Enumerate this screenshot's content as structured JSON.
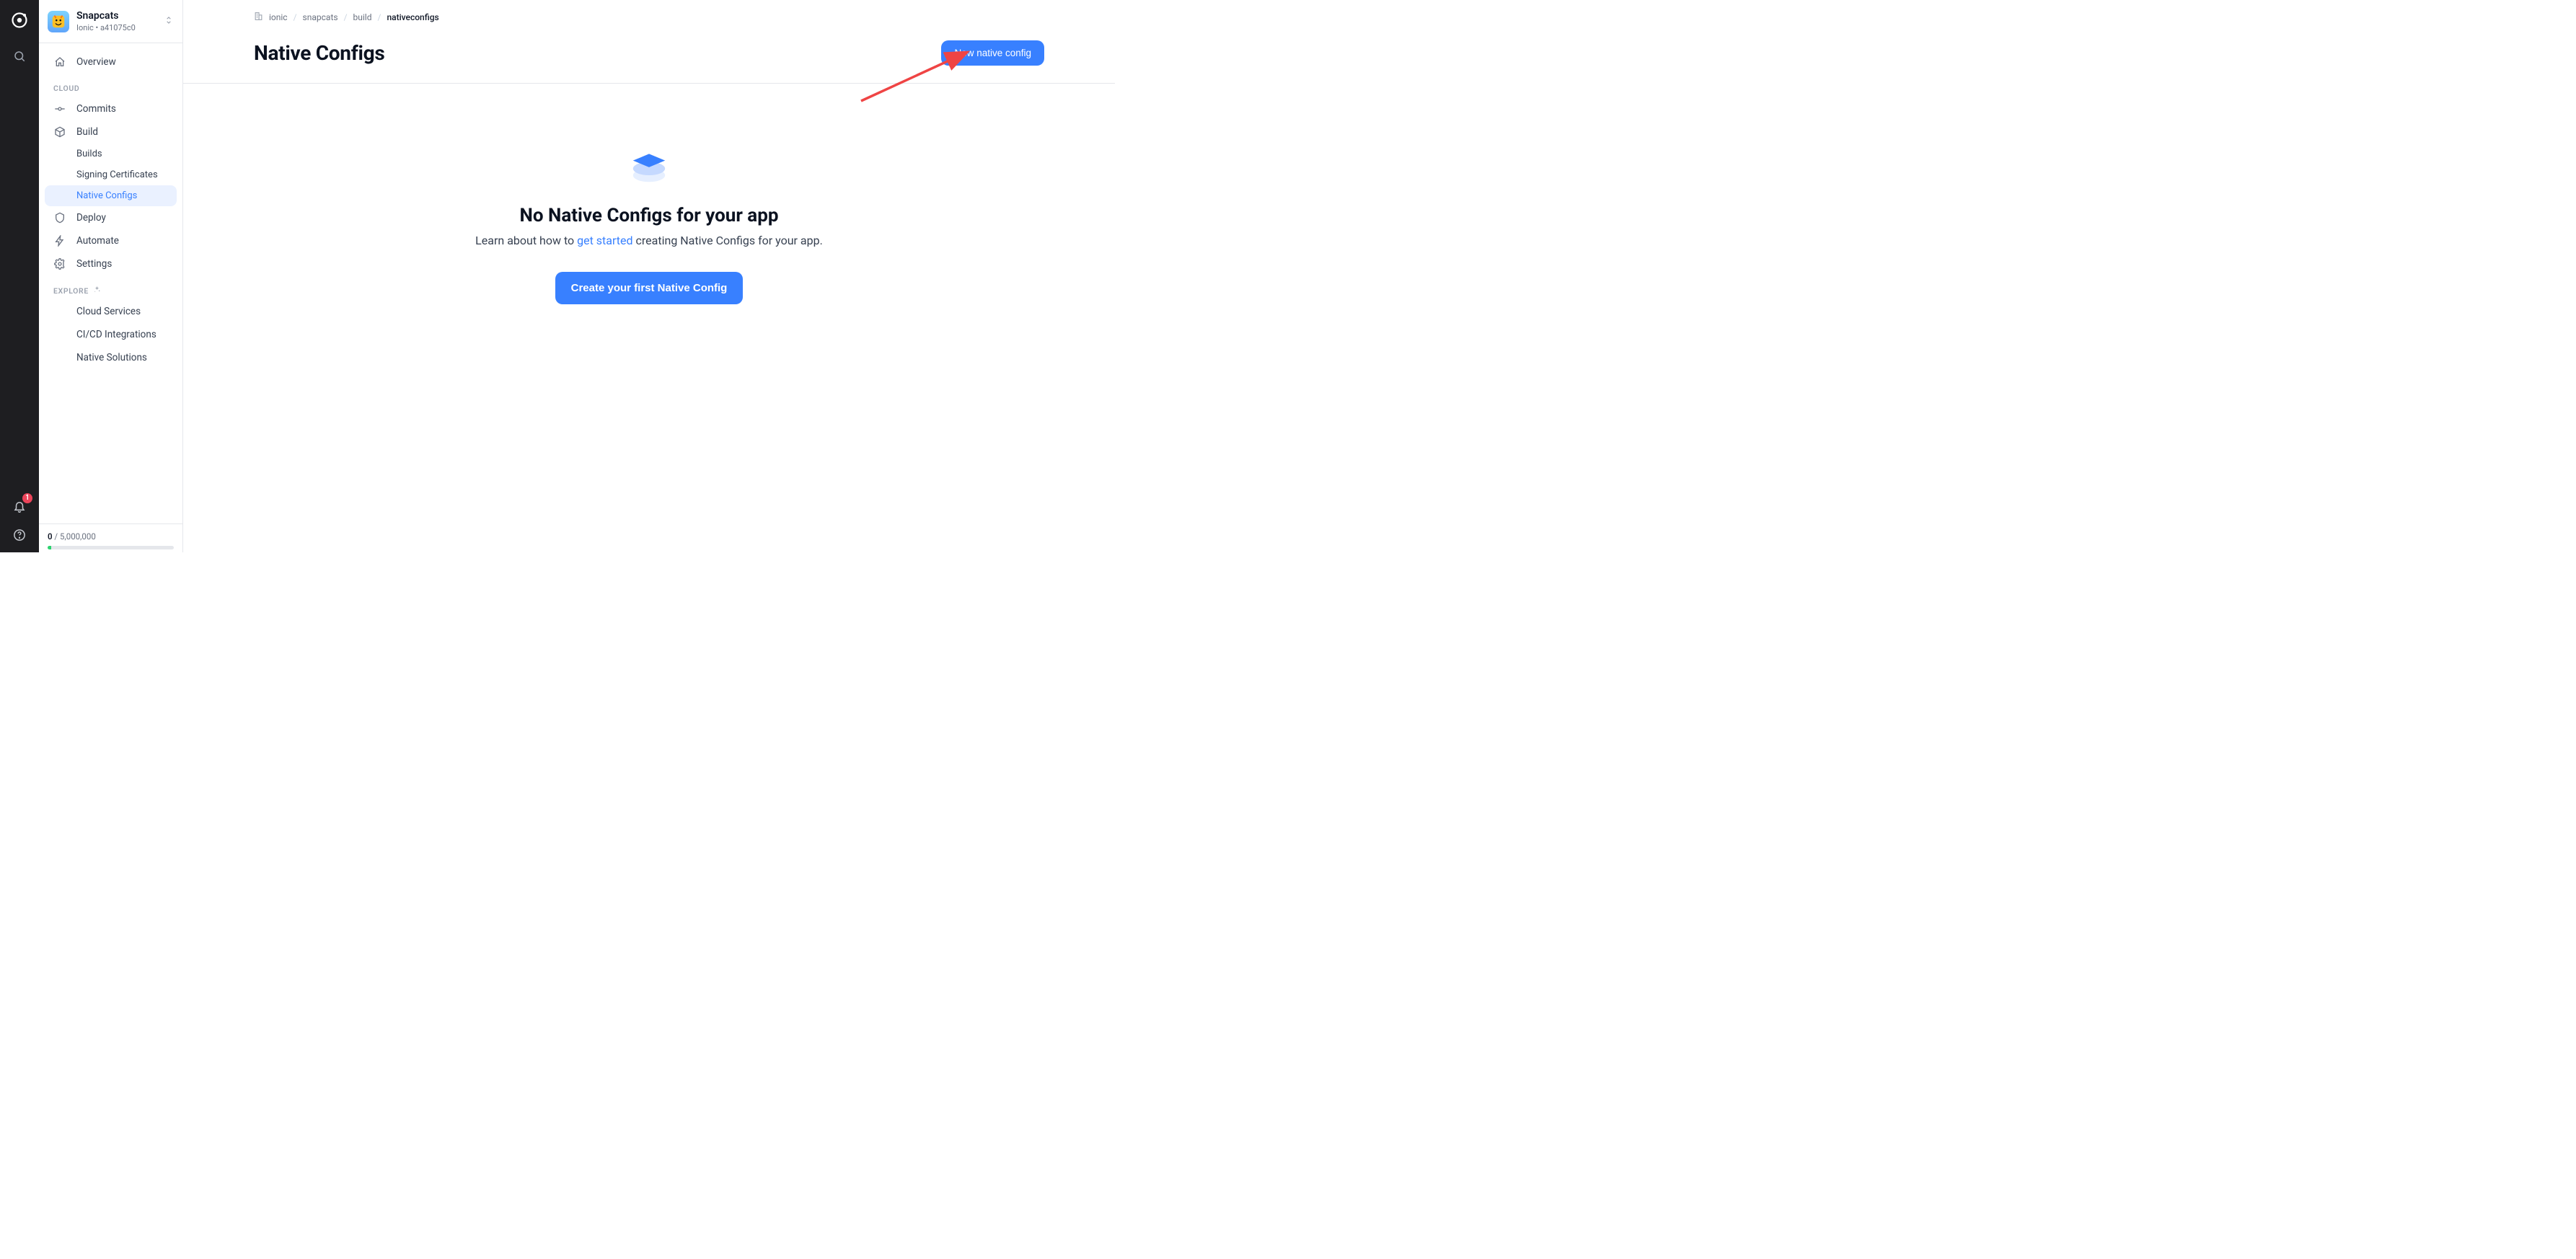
{
  "rail": {
    "notification_count": "1"
  },
  "app": {
    "name": "Snapcats",
    "org": "Ionic",
    "id": "a41075c0"
  },
  "sidebar": {
    "overview": "Overview",
    "section_cloud": "CLOUD",
    "commits": "Commits",
    "build": "Build",
    "build_sub": {
      "builds": "Builds",
      "signing": "Signing Certificates",
      "native_configs": "Native Configs"
    },
    "deploy": "Deploy",
    "automate": "Automate",
    "settings": "Settings",
    "section_explore": "EXPLORE",
    "explore": {
      "cloud": "Cloud Services",
      "cicd": "CI/CD Integrations",
      "native": "Native Solutions"
    },
    "usage": {
      "used": "0",
      "sep": " / ",
      "total": "5,000,000"
    }
  },
  "breadcrumbs": {
    "b0": "ionic",
    "b1": "snapcats",
    "b2": "build",
    "b3": "nativeconfigs"
  },
  "page": {
    "title": "Native Configs",
    "new_button": "New native config"
  },
  "empty": {
    "title": "No Native Configs for your app",
    "lead_pre": "Learn about how to ",
    "lead_link": "get started",
    "lead_post": " creating Native Configs for your app.",
    "cta": "Create your first Native Config"
  }
}
